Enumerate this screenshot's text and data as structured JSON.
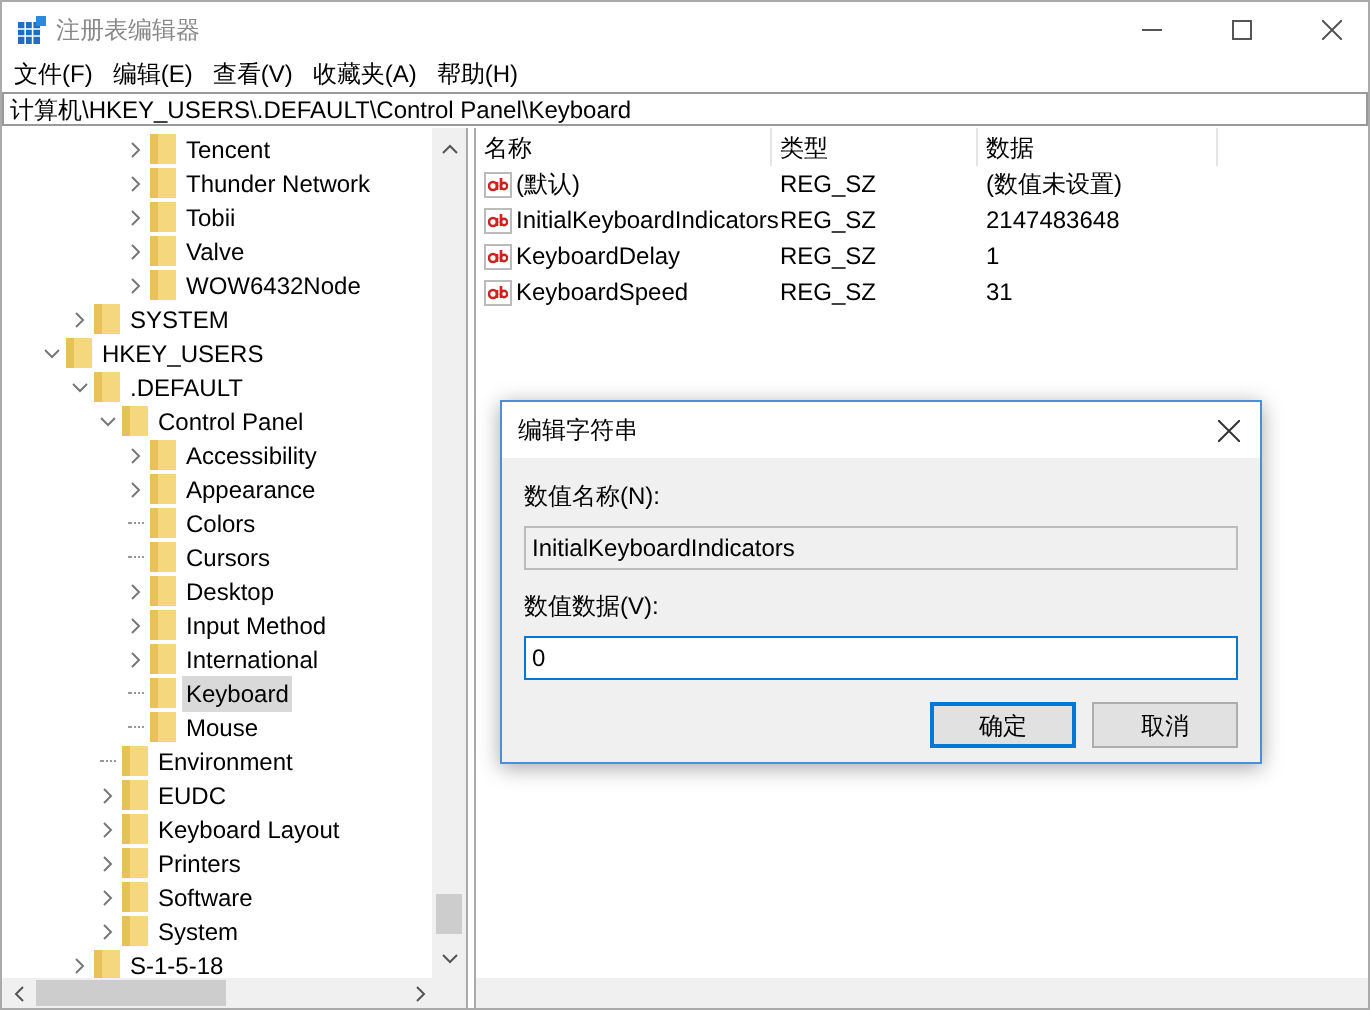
{
  "window": {
    "title": "注册表编辑器"
  },
  "menu": [
    {
      "label": "文件(F)"
    },
    {
      "label": "编辑(E)"
    },
    {
      "label": "查看(V)"
    },
    {
      "label": "收藏夹(A)"
    },
    {
      "label": "帮助(H)"
    }
  ],
  "address": "计算机\\HKEY_USERS\\.DEFAULT\\Control Panel\\Keyboard",
  "tree": [
    {
      "children": [
        {
          "children": [
            {
              "children": [
                {
                  "label": "Tencent",
                  "expanded": false,
                  "selected": false
                },
                {
                  "label": "Thunder Network",
                  "expanded": false,
                  "selected": false
                },
                {
                  "label": "Tobii",
                  "expanded": false,
                  "selected": false
                },
                {
                  "label": "Valve",
                  "expanded": false,
                  "selected": false
                },
                {
                  "label": "WOW6432Node",
                  "expanded": false,
                  "selected": false
                }
              ]
            }
          ]
        },
        {
          "label": "SYSTEM",
          "expanded": false,
          "selected": false
        }
      ]
    },
    {
      "label": "HKEY_USERS",
      "expanded": true,
      "selected": false,
      "children": [
        {
          "label": ".DEFAULT",
          "expanded": true,
          "selected": false,
          "children": [
            {
              "label": "Control Panel",
              "expanded": true,
              "selected": false,
              "children": [
                {
                  "label": "Accessibility",
                  "expanded": false,
                  "selected": false
                },
                {
                  "label": "Appearance",
                  "expanded": false,
                  "selected": false
                },
                {
                  "label": "Colors",
                  "selected": false
                },
                {
                  "label": "Cursors",
                  "selected": false
                },
                {
                  "label": "Desktop",
                  "expanded": false,
                  "selected": false
                },
                {
                  "label": "Input Method",
                  "expanded": false,
                  "selected": false
                },
                {
                  "label": "International",
                  "expanded": false,
                  "selected": false
                },
                {
                  "label": "Keyboard",
                  "selected": true
                },
                {
                  "label": "Mouse",
                  "selected": false
                }
              ]
            },
            {
              "label": "Environment",
              "selected": false
            },
            {
              "label": "EUDC",
              "expanded": false,
              "selected": false
            },
            {
              "label": "Keyboard Layout",
              "expanded": false,
              "selected": false
            },
            {
              "label": "Printers",
              "expanded": false,
              "selected": false
            },
            {
              "label": "Software",
              "expanded": false,
              "selected": false
            },
            {
              "label": "System",
              "expanded": false,
              "selected": false
            }
          ]
        },
        {
          "label": "S-1-5-18",
          "expanded": false,
          "selected": false
        }
      ]
    }
  ],
  "values": {
    "columns": [
      "名称",
      "类型",
      "数据"
    ],
    "rows": [
      {
        "name": "(默认)",
        "type": "REG_SZ",
        "data": "(数值未设置)"
      },
      {
        "name": "InitialKeyboardIndicators",
        "type": "REG_SZ",
        "data": "2147483648"
      },
      {
        "name": "KeyboardDelay",
        "type": "REG_SZ",
        "data": "1"
      },
      {
        "name": "KeyboardSpeed",
        "type": "REG_SZ",
        "data": "31"
      }
    ]
  },
  "dialog": {
    "title": "编辑字符串",
    "name_label": "数值名称(N):",
    "name_value": "InitialKeyboardIndicators",
    "data_label": "数值数据(V):",
    "data_value": "0",
    "buttons": [
      {
        "label": "确定",
        "default": true
      },
      {
        "label": "取消",
        "default": false
      }
    ]
  }
}
